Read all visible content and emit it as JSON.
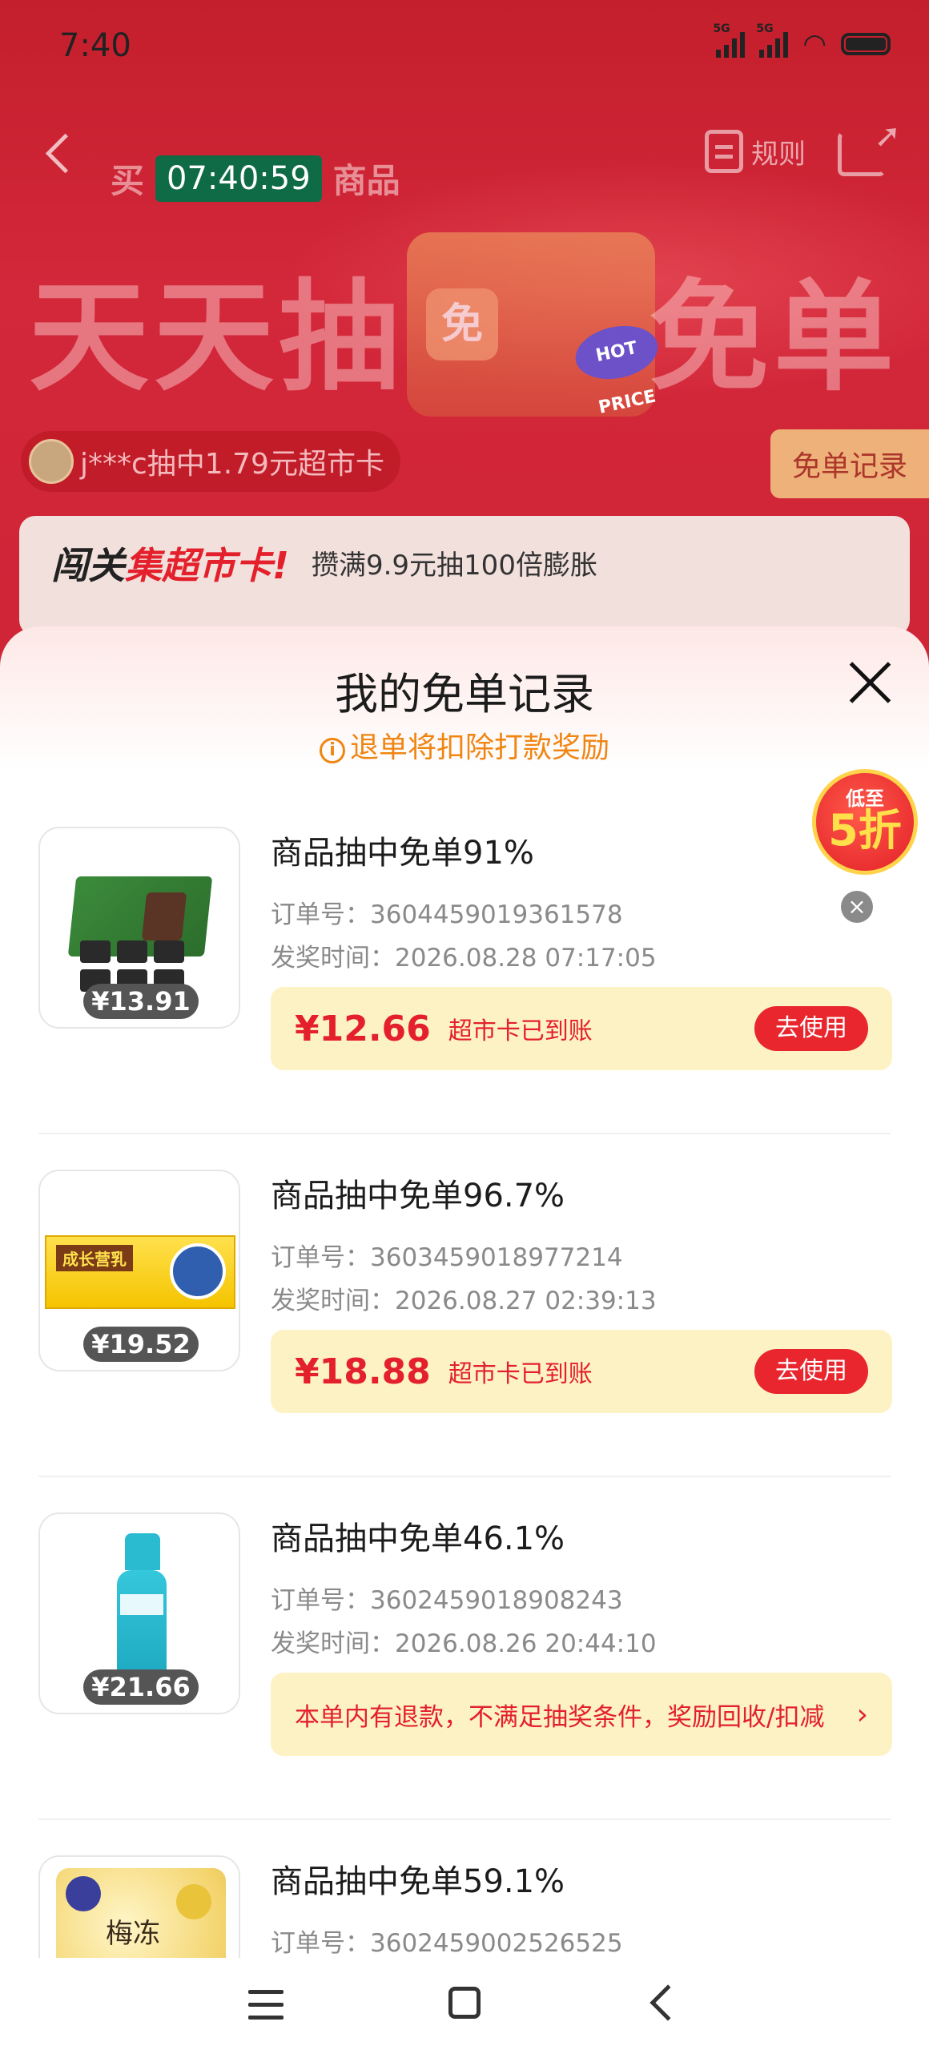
{
  "status": {
    "time": "7:40",
    "sig1": "5G",
    "sig2": "5G"
  },
  "header": {
    "timer": "07:40:59",
    "sub_left": "买",
    "sub_right": "商品",
    "rules_label": "规则",
    "title_left": "天天抽",
    "title_right": "免单",
    "bag_char": "免",
    "hot_label": "HOT PRICE"
  },
  "winner": {
    "text": "j***c抽中1.79元超市卡"
  },
  "record_button": "免单记录",
  "promo": {
    "prefix": "闯关",
    "highlight": "集超市卡!",
    "desc": "攒满9.9元抽100倍膨胀"
  },
  "sheet": {
    "title": "我的免单记录",
    "note": "退单将扣除打款奖励",
    "corner_badge_top": "低至",
    "corner_badge_big": "5折"
  },
  "records": [
    {
      "title": "商品抽中免单91%",
      "order": "订单号：3604459019361578",
      "time": "发奖时间：2026.08.28 07:17:05",
      "price": "¥13.91",
      "amount": "¥12.66",
      "status": "超市卡已到账",
      "action": "去使用"
    },
    {
      "title": "商品抽中免单96.7%",
      "order": "订单号：3603459018977214",
      "time": "发奖时间：2026.08.27 02:39:13",
      "price": "¥19.52",
      "amount": "¥18.88",
      "status": "超市卡已到账",
      "action": "去使用",
      "thumb_label": "成长营乳"
    },
    {
      "title": "商品抽中免单46.1%",
      "order": "订单号：3602459018908243",
      "time": "发奖时间：2026.08.26 20:44:10",
      "price": "¥21.66",
      "refund_note": "本单内有退款，不满足抽奖条件，奖励回收/扣减"
    },
    {
      "title": "商品抽中免单59.1%",
      "order": "订单号：3602459002526525",
      "thumb_label": "梅冻"
    }
  ]
}
